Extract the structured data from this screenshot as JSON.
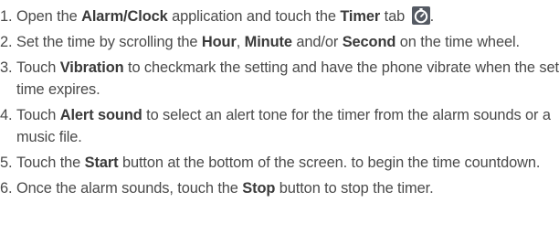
{
  "steps": [
    {
      "num": "1.",
      "parts": [
        {
          "t": "Open the "
        },
        {
          "t": "Alarm/Clock",
          "b": true
        },
        {
          "t": " application and touch the "
        },
        {
          "t": "Timer",
          "b": true
        },
        {
          "t": " tab "
        },
        {
          "icon": "timer-tab-icon"
        },
        {
          "t": "."
        }
      ]
    },
    {
      "num": "2.",
      "parts": [
        {
          "t": "Set the time by scrolling the "
        },
        {
          "t": "Hour",
          "b": true
        },
        {
          "t": ", "
        },
        {
          "t": "Minute",
          "b": true
        },
        {
          "t": " and/or "
        },
        {
          "t": "Second",
          "b": true
        },
        {
          "t": " on the time wheel."
        }
      ]
    },
    {
      "num": "3.",
      "parts": [
        {
          "t": "Touch "
        },
        {
          "t": "Vibration",
          "b": true
        },
        {
          "t": " to checkmark the setting and have the phone vibrate when the set time expires."
        }
      ]
    },
    {
      "num": "4.",
      "parts": [
        {
          "t": "Touch "
        },
        {
          "t": "Alert sound",
          "b": true
        },
        {
          "t": " to select an alert tone for the timer from the alarm sounds or a music file."
        }
      ]
    },
    {
      "num": "5.",
      "parts": [
        {
          "t": "Touch the "
        },
        {
          "t": "Start",
          "b": true
        },
        {
          "t": " button at the bottom of the screen. to begin the time countdown."
        }
      ]
    },
    {
      "num": "6.",
      "parts": [
        {
          "t": "Once the alarm sounds, touch the "
        },
        {
          "t": "Stop",
          "b": true
        },
        {
          "t": " button to stop the timer."
        }
      ]
    }
  ],
  "colors": {
    "text": "#4a4a4a",
    "bold_text": "#3a3a3a",
    "icon_bg": "#555a63",
    "icon_fg": "#ffffff"
  }
}
